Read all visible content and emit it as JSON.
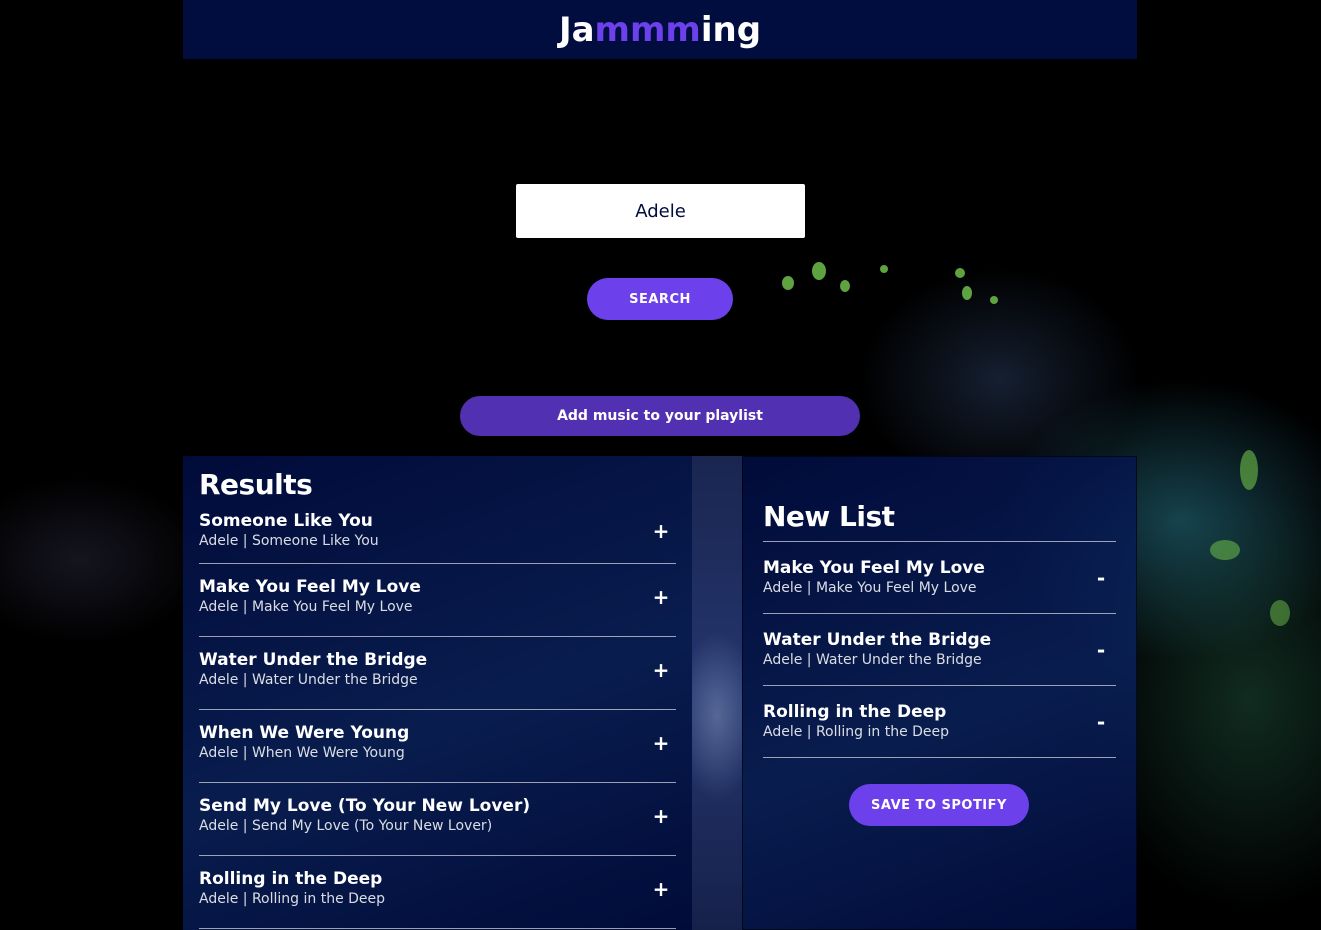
{
  "header": {
    "logo_part1": "Ja",
    "logo_part2": "mmm",
    "logo_part3": "ing"
  },
  "search": {
    "value": "Adele",
    "button_label": "SEARCH"
  },
  "hint": {
    "text": "Add music to your playlist"
  },
  "results": {
    "title": "Results",
    "action_symbol": "+",
    "tracks": [
      {
        "name": "Someone Like You",
        "meta": "Adele | Someone Like You"
      },
      {
        "name": "Make You Feel My Love",
        "meta": "Adele | Make You Feel My Love"
      },
      {
        "name": "Water Under the Bridge",
        "meta": "Adele | Water Under the Bridge"
      },
      {
        "name": "When We Were Young",
        "meta": "Adele | When We Were Young"
      },
      {
        "name": "Send My Love (To Your New Lover)",
        "meta": "Adele | Send My Love (To Your New Lover)"
      },
      {
        "name": "Rolling in the Deep",
        "meta": "Adele | Rolling in the Deep"
      }
    ]
  },
  "playlist": {
    "title": "New List",
    "action_symbol": "-",
    "save_label": "SAVE TO SPOTIFY",
    "tracks": [
      {
        "name": "Make You Feel My Love",
        "meta": "Adele | Make You Feel My Love"
      },
      {
        "name": "Water Under the Bridge",
        "meta": "Adele | Water Under the Bridge"
      },
      {
        "name": "Rolling in the Deep",
        "meta": "Adele | Rolling in the Deep"
      }
    ]
  },
  "colors": {
    "brand_purple": "#6c41ec",
    "header_navy": "#010c3f"
  }
}
